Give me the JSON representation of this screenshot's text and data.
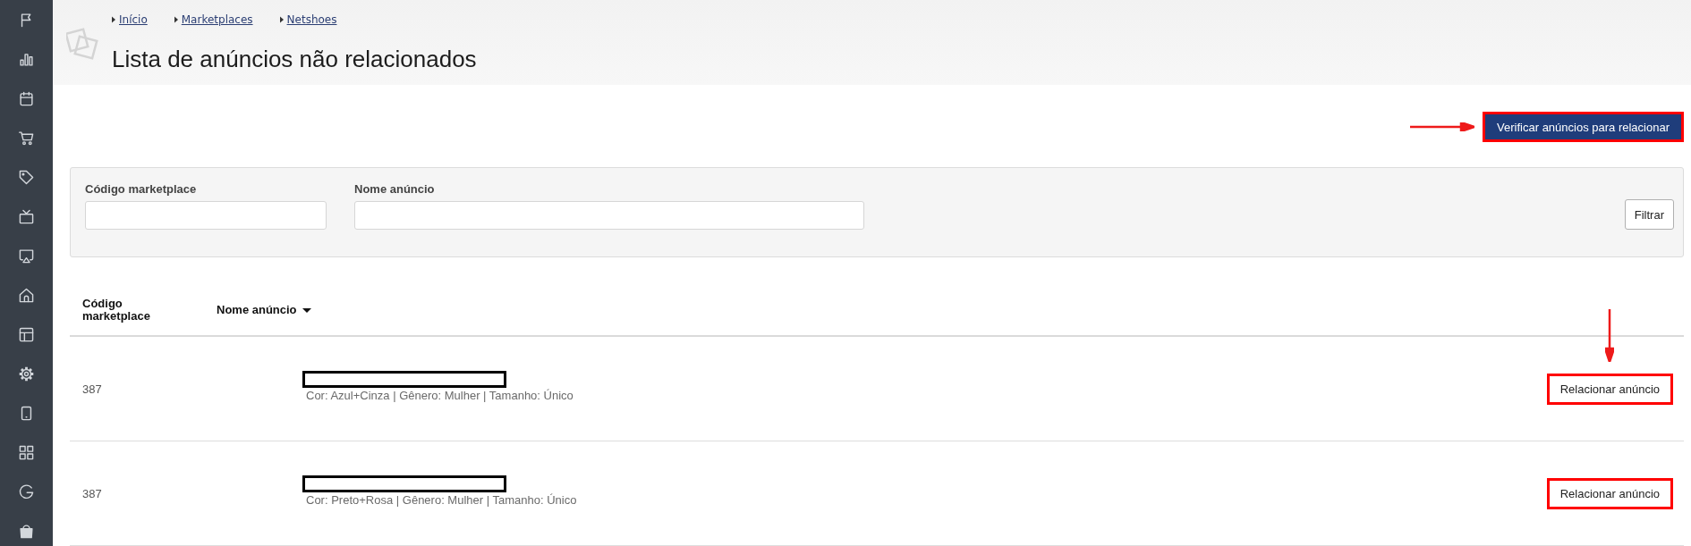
{
  "breadcrumb": [
    {
      "label": "Início"
    },
    {
      "label": "Marketplaces"
    },
    {
      "label": "Netshoes"
    }
  ],
  "page_title": "Lista de anúncios não relacionados",
  "verify_button": {
    "label": "Verificar anúncios para relacionar",
    "highlighted": true,
    "arrow": true
  },
  "filters": {
    "fields": [
      {
        "label": "Código marketplace"
      },
      {
        "label": "Nome anúncio"
      }
    ],
    "button": "Filtrar"
  },
  "table": {
    "columns": [
      {
        "label": "Código marketplace",
        "sorted": false
      },
      {
        "label": "Nome anúncio",
        "sorted": true
      }
    ],
    "rows": [
      {
        "code": "387",
        "details": "Cor: Azul+Cinza | Gênero: Mulher | Tamanho: Único",
        "action": "Relacionar anúncio",
        "highlighted": true,
        "arrow": true
      },
      {
        "code": "387",
        "details": "Cor: Preto+Rosa | Gênero: Mulher | Tamanho: Único",
        "action": "Relacionar anúncio",
        "highlighted": true,
        "arrow": false
      }
    ]
  }
}
